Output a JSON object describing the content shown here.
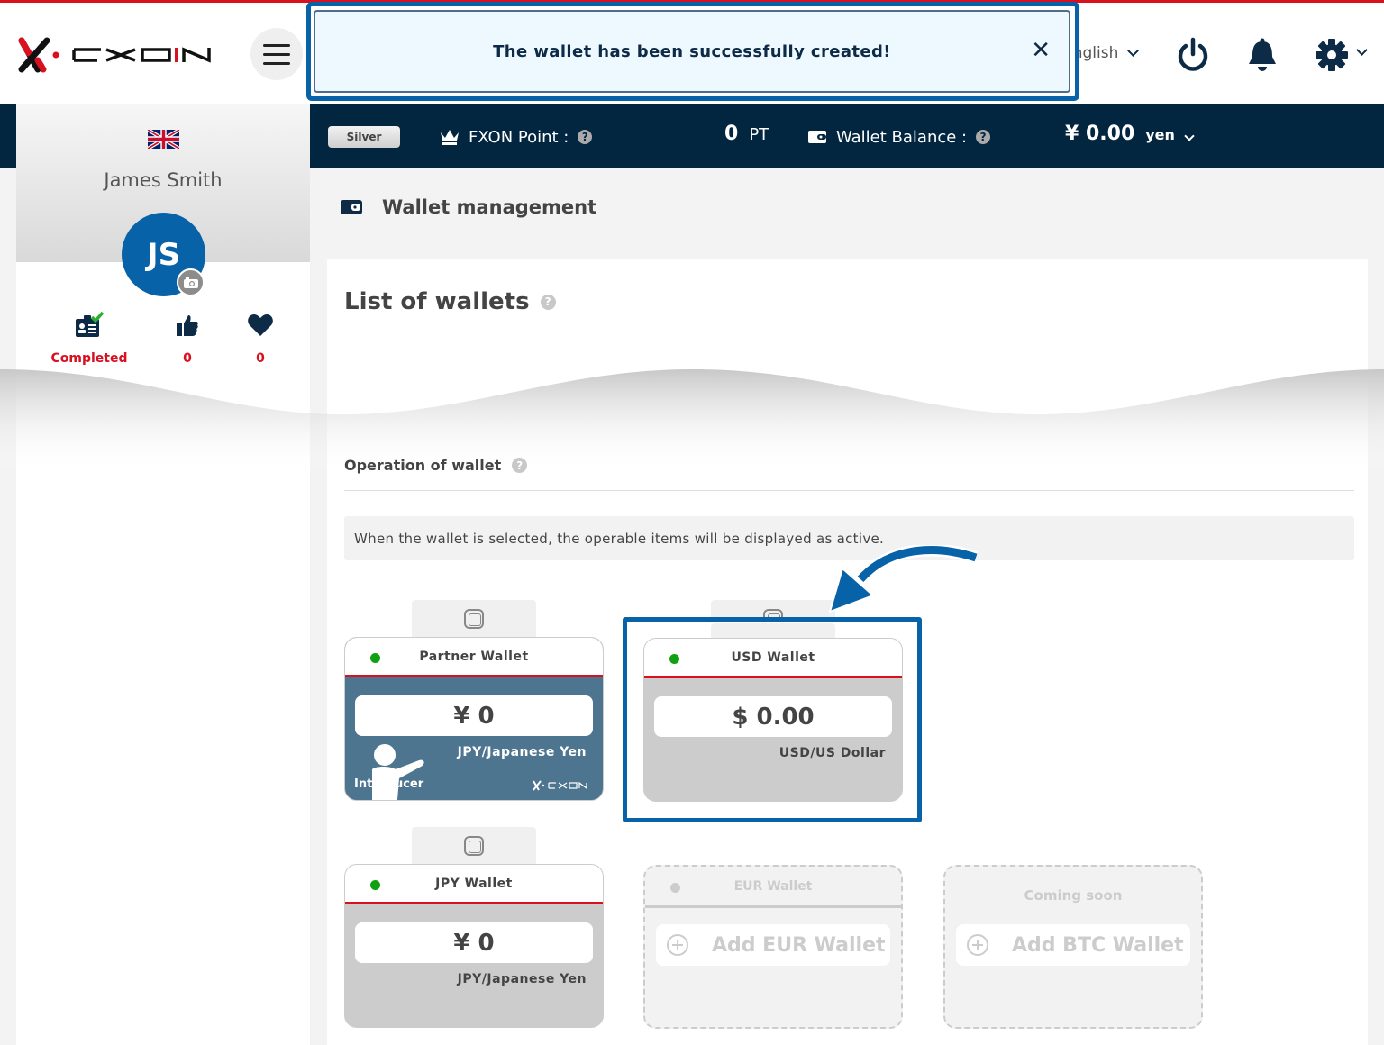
{
  "header": {
    "brand": "FXON",
    "menu_icon": "hamburger-icon",
    "language": "English",
    "icons": [
      "power-icon",
      "bell-icon",
      "gear-icon"
    ]
  },
  "toast": {
    "message": "The wallet has been successfully created!",
    "close_label": "✕"
  },
  "statusbar": {
    "rank": "Silver",
    "points_label": "FXON Point :",
    "points_value": "0",
    "points_unit": "PT",
    "balance_label": "Wallet Balance :",
    "balance_value": "¥ 0.00",
    "balance_unit": "yen",
    "help": "?"
  },
  "sidebar": {
    "flag": "uk-flag",
    "user_name": "James Smith",
    "avatar_initials": "JS",
    "stats": [
      {
        "icon": "id-card-check-icon",
        "label": "Completed"
      },
      {
        "icon": "thumbs-up-icon",
        "label": "0"
      },
      {
        "icon": "heart-icon",
        "label": "0"
      }
    ]
  },
  "main": {
    "page_title": "Wallet management",
    "list_title": "List of wallets",
    "operation_title": "Operation of wallet",
    "info_text": "When the wallet is selected, the operable items will be displayed as active.",
    "help": "?"
  },
  "wallets": [
    {
      "name": "Partner Wallet",
      "amount": "¥ 0",
      "currency": "JPY/Japanese Yen",
      "status": "active",
      "badge": "Introducer",
      "brand": "FXON"
    },
    {
      "name": "USD Wallet",
      "amount": "$ 0.00",
      "currency": "USD/US Dollar",
      "status": "active",
      "highlighted": true
    },
    {
      "name": "JPY Wallet",
      "amount": "¥ 0",
      "currency": "JPY/Japanese Yen",
      "status": "active"
    }
  ],
  "empty_wallets": [
    {
      "name": "EUR Wallet",
      "action": "Add EUR Wallet"
    },
    {
      "name": "Coming soon",
      "action": "Add BTC Wallet"
    }
  ],
  "colors": {
    "brand_red": "#d8101f",
    "navy": "#022640",
    "highlight_blue": "#0862a8",
    "active_green": "#10a010",
    "partner_card": "#4e7590"
  }
}
